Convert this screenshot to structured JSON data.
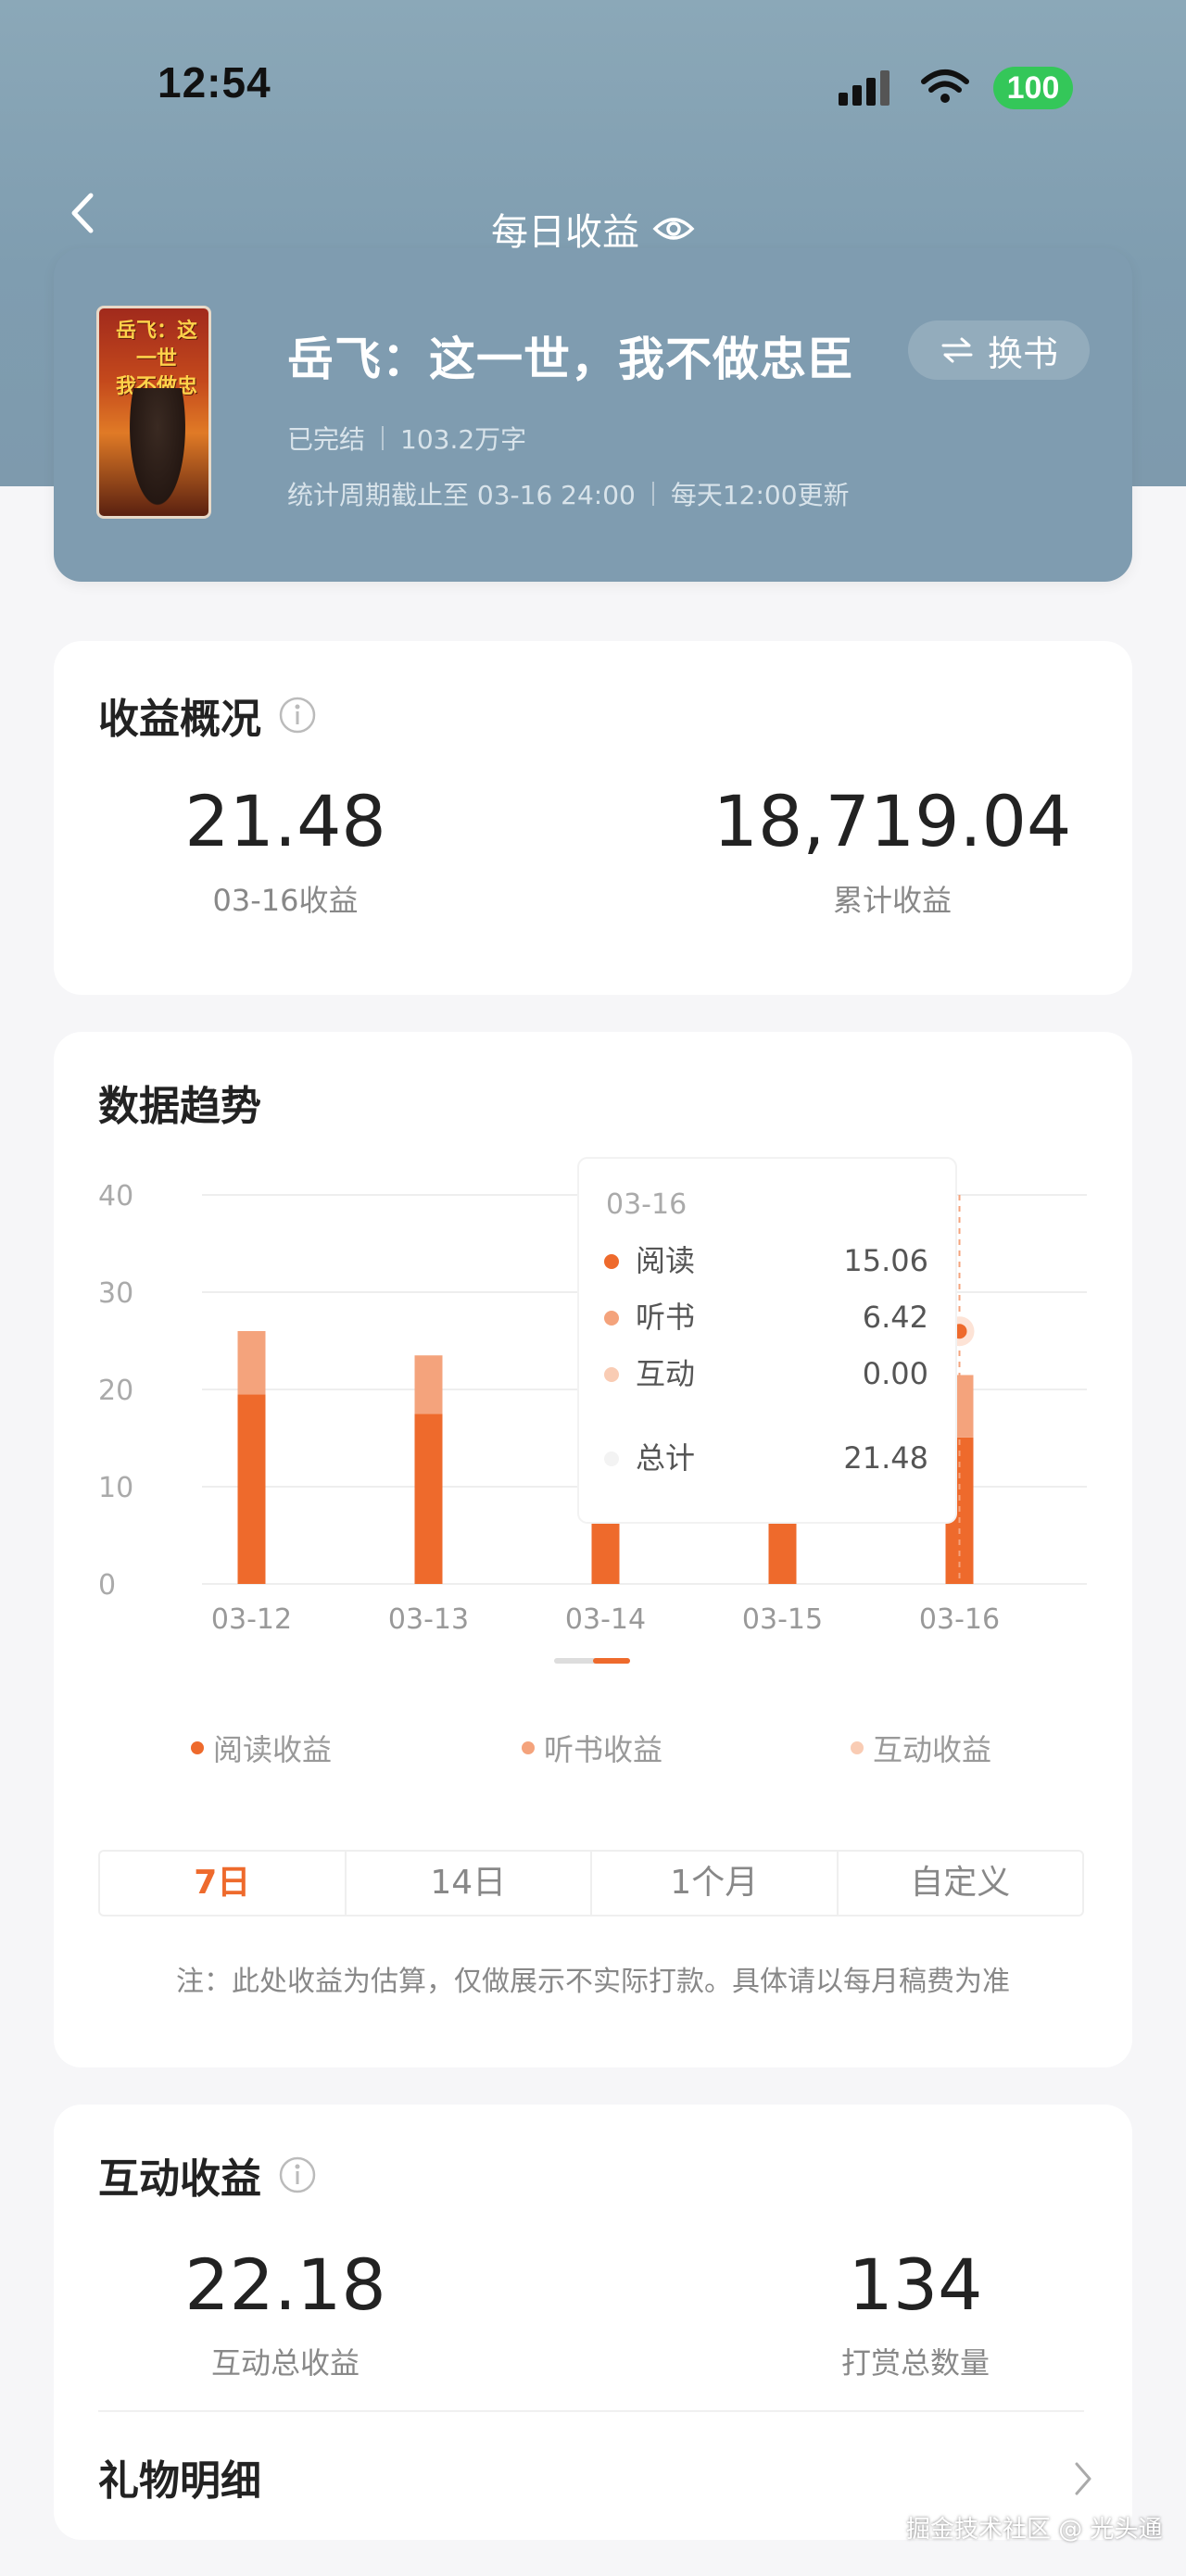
{
  "status_bar": {
    "time": "12:54",
    "battery": "100"
  },
  "header": {
    "title": "每日收益"
  },
  "book": {
    "cover_line1": "岳飞：这一世",
    "cover_line2": "我不做忠臣",
    "title": "岳飞：这一世，我不做忠臣",
    "swap_label": "换书",
    "status": "已完结",
    "word_count": "103.2万字",
    "period": "统计周期截止至 03-16 24:00",
    "update": "每天12:00更新"
  },
  "overview": {
    "title": "收益概况",
    "daily_value": "21.48",
    "daily_label": "03-16收益",
    "total_value": "18,719.04",
    "total_label": "累计收益"
  },
  "trend": {
    "title": "数据趋势",
    "tooltip": {
      "date": "03-16",
      "rows": [
        {
          "label": "阅读",
          "value": "15.06",
          "color": "#ee6a2c"
        },
        {
          "label": "听书",
          "value": "6.42",
          "color": "#f4a37c"
        },
        {
          "label": "互动",
          "value": "0.00",
          "color": "#f9ccb4"
        }
      ],
      "total_label": "总计",
      "total_value": "21.48"
    },
    "legend": [
      {
        "label": "阅读收益",
        "color": "#ee6a2c"
      },
      {
        "label": "听书收益",
        "color": "#f4a37c"
      },
      {
        "label": "互动收益",
        "color": "#f9ccb4"
      }
    ],
    "ranges": [
      "7日",
      "14日",
      "1个月",
      "自定义"
    ],
    "active_range": "7日",
    "note": "注：此处收益为估算，仅做展示不实际打款。具体请以每月稿费为准"
  },
  "chart_data": {
    "type": "bar",
    "stacked": true,
    "categories": [
      "03-12",
      "03-13",
      "03-14",
      "03-15",
      "03-16"
    ],
    "series": [
      {
        "name": "阅读",
        "values": [
          19.5,
          17.5,
          15.0,
          15.0,
          15.06
        ],
        "color": "#ee6a2c"
      },
      {
        "name": "听书",
        "values": [
          6.5,
          6.0,
          6.0,
          6.0,
          6.42
        ],
        "color": "#f4a37c"
      },
      {
        "name": "互动",
        "values": [
          0,
          0,
          0,
          0,
          0.0
        ],
        "color": "#f9ccb4"
      }
    ],
    "ylim": [
      0,
      40
    ],
    "yticks": [
      0,
      10,
      20,
      30,
      40
    ],
    "grid": true,
    "highlight_index": 4
  },
  "interaction": {
    "title": "互动收益",
    "total_value": "22.18",
    "total_label": "互动总收益",
    "count_value": "134",
    "count_label": "打赏总数量",
    "gift_row": "礼物明细"
  },
  "watermark": "掘金技术社区 @ 光头通"
}
